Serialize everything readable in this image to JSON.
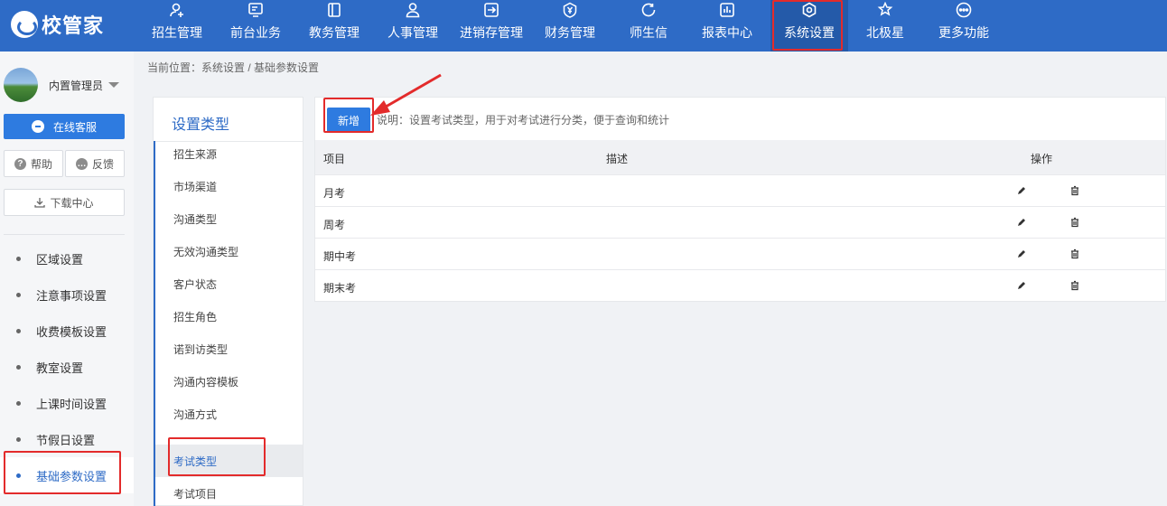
{
  "brand": {
    "name": "校管家"
  },
  "nav": {
    "items": [
      {
        "label": "招生管理",
        "icon": "person-add-icon"
      },
      {
        "label": "前台业务",
        "icon": "monitor-icon"
      },
      {
        "label": "教务管理",
        "icon": "book-icon"
      },
      {
        "label": "人事管理",
        "icon": "person-icon"
      },
      {
        "label": "进销存管理",
        "icon": "box-arrow-icon"
      },
      {
        "label": "财务管理",
        "icon": "yen-shield-icon"
      },
      {
        "label": "师生信",
        "icon": "chat-icon"
      },
      {
        "label": "报表中心",
        "icon": "bar-chart-icon"
      },
      {
        "label": "系统设置",
        "icon": "gear-icon",
        "active": true
      },
      {
        "label": "北极星",
        "icon": "star-icon"
      },
      {
        "label": "更多功能",
        "icon": "more-icon"
      }
    ]
  },
  "sidebar": {
    "user_name": "内置管理员",
    "online_service": "在线客服",
    "help": "帮助",
    "feedback": "反馈",
    "download_center": "下载中心",
    "menu": [
      {
        "label": "区域设置"
      },
      {
        "label": "注意事项设置"
      },
      {
        "label": "收费模板设置"
      },
      {
        "label": "教室设置"
      },
      {
        "label": "上课时间设置"
      },
      {
        "label": "节假日设置"
      },
      {
        "label": "基础参数设置",
        "active": true
      }
    ]
  },
  "breadcrumb": "当前位置：系统设置 / 基础参数设置",
  "type_panel": {
    "title": "设置类型",
    "items": [
      {
        "label": "招生来源"
      },
      {
        "label": "市场渠道"
      },
      {
        "label": "沟通类型"
      },
      {
        "label": "无效沟通类型"
      },
      {
        "label": "客户状态"
      },
      {
        "label": "招生角色"
      },
      {
        "label": "诺到访类型"
      },
      {
        "label": "沟通内容模板"
      },
      {
        "label": "沟通方式"
      },
      {
        "label": "考试类型",
        "active": true
      },
      {
        "label": "考试项目"
      }
    ]
  },
  "content": {
    "add_label": "新增",
    "hint": "说明：设置考试类型，用于对考试进行分类，便于查询和统计",
    "columns": {
      "item": "项目",
      "desc": "描述",
      "ops": "操作"
    },
    "rows": [
      {
        "item": "月考",
        "desc": ""
      },
      {
        "item": "周考",
        "desc": ""
      },
      {
        "item": "期中考",
        "desc": ""
      },
      {
        "item": "期末考",
        "desc": ""
      }
    ]
  },
  "colors": {
    "primary": "#2e6bc6",
    "button": "#2e7be0",
    "highlight": "#e32b2b"
  }
}
